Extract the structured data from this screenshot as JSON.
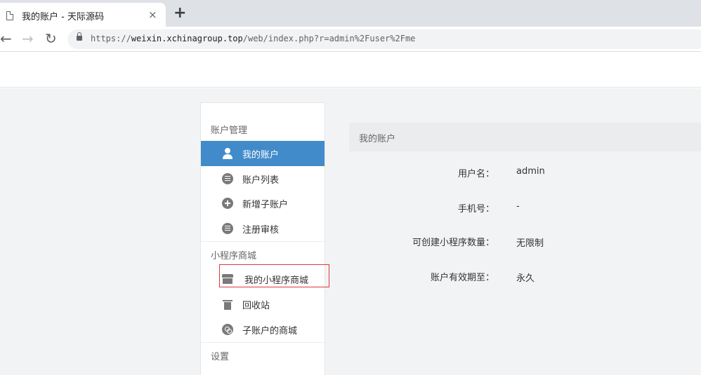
{
  "browser": {
    "tab_title": "我的账户 - 天际源码",
    "tab_close": "×",
    "new_tab": "+",
    "back": "←",
    "forward": "→",
    "reload": "↻",
    "url_scheme": "https://",
    "url_host": "weixin.xchinagroup.top",
    "url_path": "/web/index.php?r=admin%2Fuser%2Fme"
  },
  "sidebar": {
    "group_account": "账户管理",
    "items_account": [
      {
        "label": "我的账户",
        "icon": "user-icon",
        "active": true
      },
      {
        "label": "账户列表",
        "icon": "list-icon"
      },
      {
        "label": "新增子账户",
        "icon": "plus-icon"
      },
      {
        "label": "注册审核",
        "icon": "list-icon"
      }
    ],
    "group_store": "小程序商城",
    "items_store": [
      {
        "label": "我的小程序商城",
        "icon": "store-icon"
      },
      {
        "label": "回收站",
        "icon": "trash-icon"
      },
      {
        "label": "子账户的商城",
        "icon": "link-icon"
      }
    ],
    "group_settings": "设置"
  },
  "main": {
    "header": "我的账户",
    "fields": [
      {
        "label": "用户名：",
        "value": "admin"
      },
      {
        "label": "手机号：",
        "value": "-"
      },
      {
        "label": "可创建小程序数量：",
        "value": "无限制"
      },
      {
        "label": "账户有效期至：",
        "value": "永久"
      }
    ]
  },
  "colors": {
    "active_item": "#428bca",
    "highlight_box": "#e0393e"
  }
}
